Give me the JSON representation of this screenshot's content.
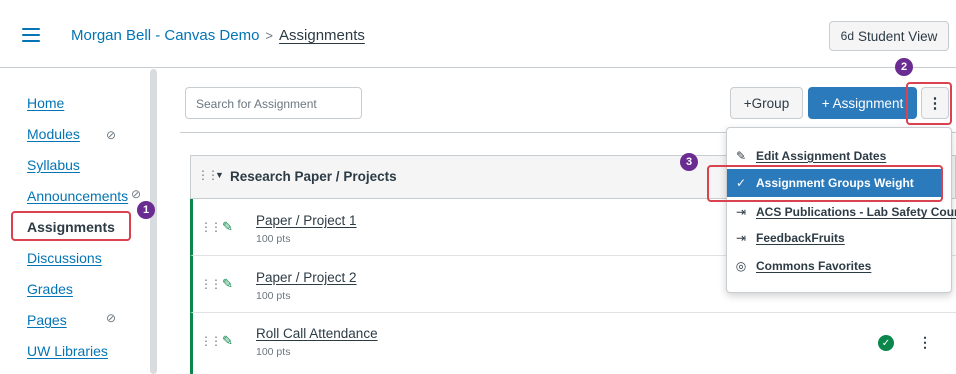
{
  "header": {
    "course": "Morgan Bell - Canvas Demo",
    "separator": ">",
    "current": "Assignments",
    "student_view": "Student View"
  },
  "sidebar": {
    "items": [
      {
        "label": "Home",
        "hidden": false
      },
      {
        "label": "Modules",
        "hidden": true
      },
      {
        "label": "Syllabus",
        "hidden": false
      },
      {
        "label": "Announcements",
        "hidden": true
      },
      {
        "label": "Assignments",
        "hidden": false,
        "active": true
      },
      {
        "label": "Discussions",
        "hidden": false
      },
      {
        "label": "Grades",
        "hidden": false
      },
      {
        "label": "Pages",
        "hidden": true
      },
      {
        "label": "UW Libraries",
        "hidden": false
      }
    ]
  },
  "toolbar": {
    "search_placeholder": "Search for Assignment",
    "group_button": "+Group",
    "assignment_button": "+ Assignment",
    "kebab": "⋮"
  },
  "group": {
    "title": "Research Paper / Projects"
  },
  "assignments": [
    {
      "title": "Paper / Project 1",
      "points": "100 pts"
    },
    {
      "title": "Paper / Project 2",
      "points": "100 pts"
    },
    {
      "title": "Roll Call Attendance",
      "points": "100 pts",
      "published": true
    }
  ],
  "menu": {
    "items": [
      {
        "label": "Edit Assignment Dates",
        "icon": "pencil-icon"
      },
      {
        "label": "Assignment Groups Weight",
        "icon": "checkmark-icon",
        "selected": true
      },
      {
        "label": "ACS Publications - Lab Safety Course",
        "icon": "external-tool-icon"
      },
      {
        "label": "FeedbackFruits",
        "icon": "external-tool-icon"
      },
      {
        "label": "Commons Favorites",
        "icon": "commons-icon"
      }
    ]
  },
  "annotations": {
    "badges": [
      "1",
      "2",
      "3"
    ],
    "color": "#6a2c91",
    "highlight_color": "#d9424e"
  },
  "colors": {
    "link": "#0374b5",
    "primary_button": "#2b7abc",
    "published": "#0b874b"
  }
}
